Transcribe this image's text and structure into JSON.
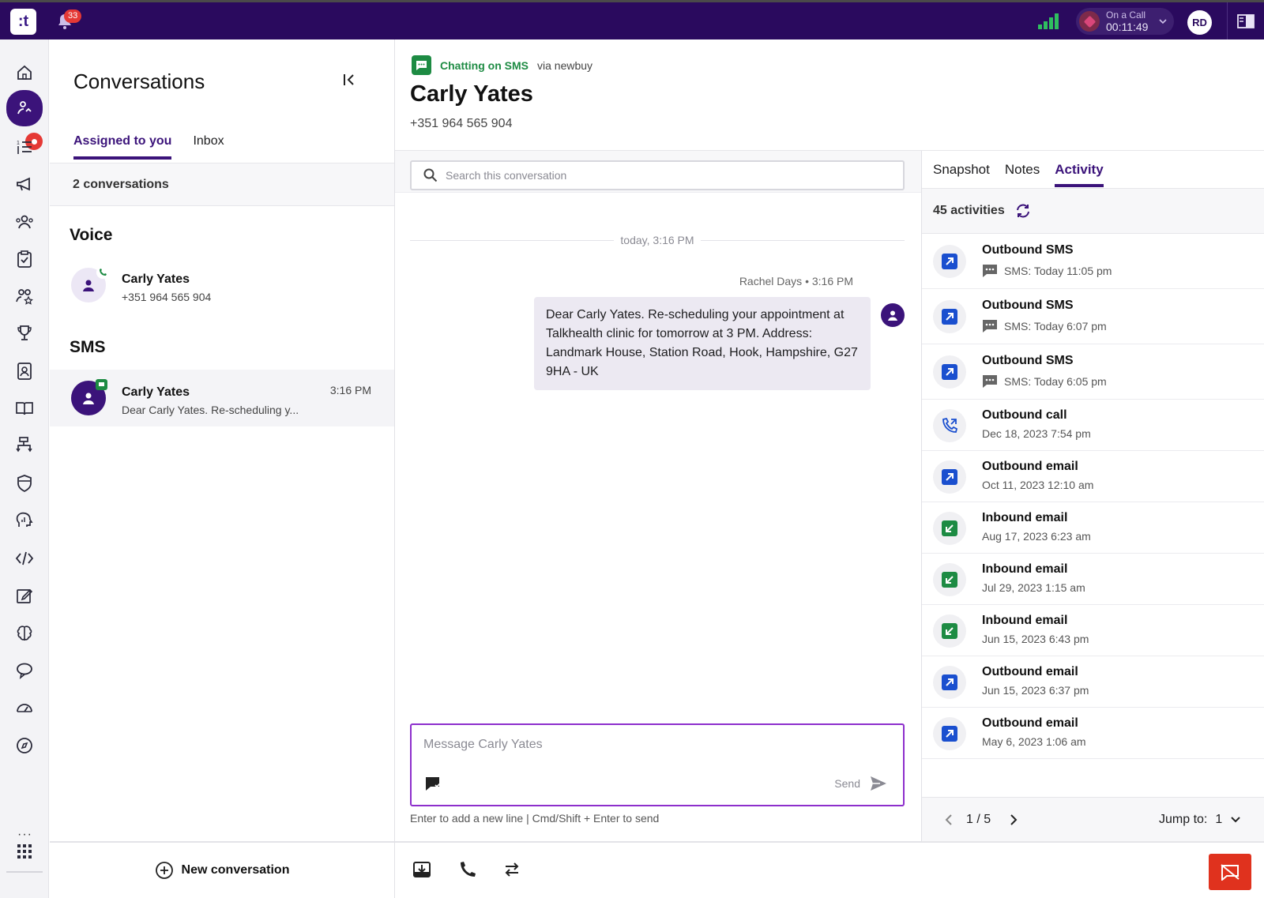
{
  "topbar": {
    "logo_text": ":t",
    "notification_count": "33",
    "call_status_label": "On a Call",
    "call_timer": "00:11:49",
    "user_initials": "RD"
  },
  "conversations": {
    "title": "Conversations",
    "tabs": [
      {
        "label": "Assigned to you",
        "active": true
      },
      {
        "label": "Inbox",
        "active": false
      }
    ],
    "count_text": "2 conversations",
    "voice_section": "Voice",
    "sms_section": "SMS",
    "voice_item": {
      "name": "Carly Yates",
      "sub": "+351 964 565 904"
    },
    "sms_item": {
      "name": "Carly Yates",
      "sub": "Dear Carly Yates. Re-scheduling y...",
      "time": "3:16 PM"
    },
    "new_button": "New conversation"
  },
  "chat": {
    "channel_label": "Chatting on SMS",
    "channel_via": "via newbuy",
    "contact_name": "Carly Yates",
    "contact_phone": "+351 964 565 904",
    "search_placeholder": "Search this conversation",
    "date_separator": "today, 3:16 PM",
    "message": {
      "meta": "Rachel Days • 3:16 PM",
      "text": "Dear Carly Yates. Re-scheduling your appointment at Talkhealth clinic for tomorrow at 3 PM. Address: Landmark House, Station Road, Hook, Hampshire, G27 9HA - UK"
    },
    "compose_placeholder": "Message Carly Yates",
    "send_label": "Send",
    "compose_hint": "Enter to add a new line | Cmd/Shift + Enter to send"
  },
  "activity": {
    "tabs": [
      {
        "label": "Snapshot",
        "active": false
      },
      {
        "label": "Notes",
        "active": false
      },
      {
        "label": "Activity",
        "active": true
      }
    ],
    "count_text": "45 activities",
    "items": [
      {
        "title": "Outbound SMS",
        "sub": "SMS: Today 11:05 pm",
        "kind": "out",
        "sms": true
      },
      {
        "title": "Outbound SMS",
        "sub": "SMS: Today 6:07 pm",
        "kind": "out",
        "sms": true
      },
      {
        "title": "Outbound SMS",
        "sub": "SMS: Today 6:05 pm",
        "kind": "out",
        "sms": true
      },
      {
        "title": "Outbound call",
        "sub": "Dec 18, 2023 7:54 pm",
        "kind": "call",
        "sms": false
      },
      {
        "title": "Outbound email",
        "sub": "Oct 11, 2023 12:10 am",
        "kind": "out",
        "sms": false
      },
      {
        "title": "Inbound email",
        "sub": "Aug 17, 2023 6:23 am",
        "kind": "in",
        "sms": false
      },
      {
        "title": "Inbound email",
        "sub": "Jul 29, 2023 1:15 am",
        "kind": "in",
        "sms": false
      },
      {
        "title": "Inbound email",
        "sub": "Jun 15, 2023 6:43 pm",
        "kind": "in",
        "sms": false
      },
      {
        "title": "Outbound email",
        "sub": "Jun 15, 2023 6:37 pm",
        "kind": "out",
        "sms": false
      },
      {
        "title": "Outbound email",
        "sub": "May 6, 2023 1:06 am",
        "kind": "out",
        "sms": false
      }
    ],
    "page_text": "1 / 5",
    "jump_label": "Jump to:",
    "jump_value": "1"
  },
  "colors": {
    "brand": "#2a0a5e",
    "accent": "#3b137a",
    "sms_green": "#1d8b43",
    "outbound_blue": "#1a4fcf",
    "inbound_green": "#1d8b43",
    "end_call_red": "#e0321e"
  }
}
